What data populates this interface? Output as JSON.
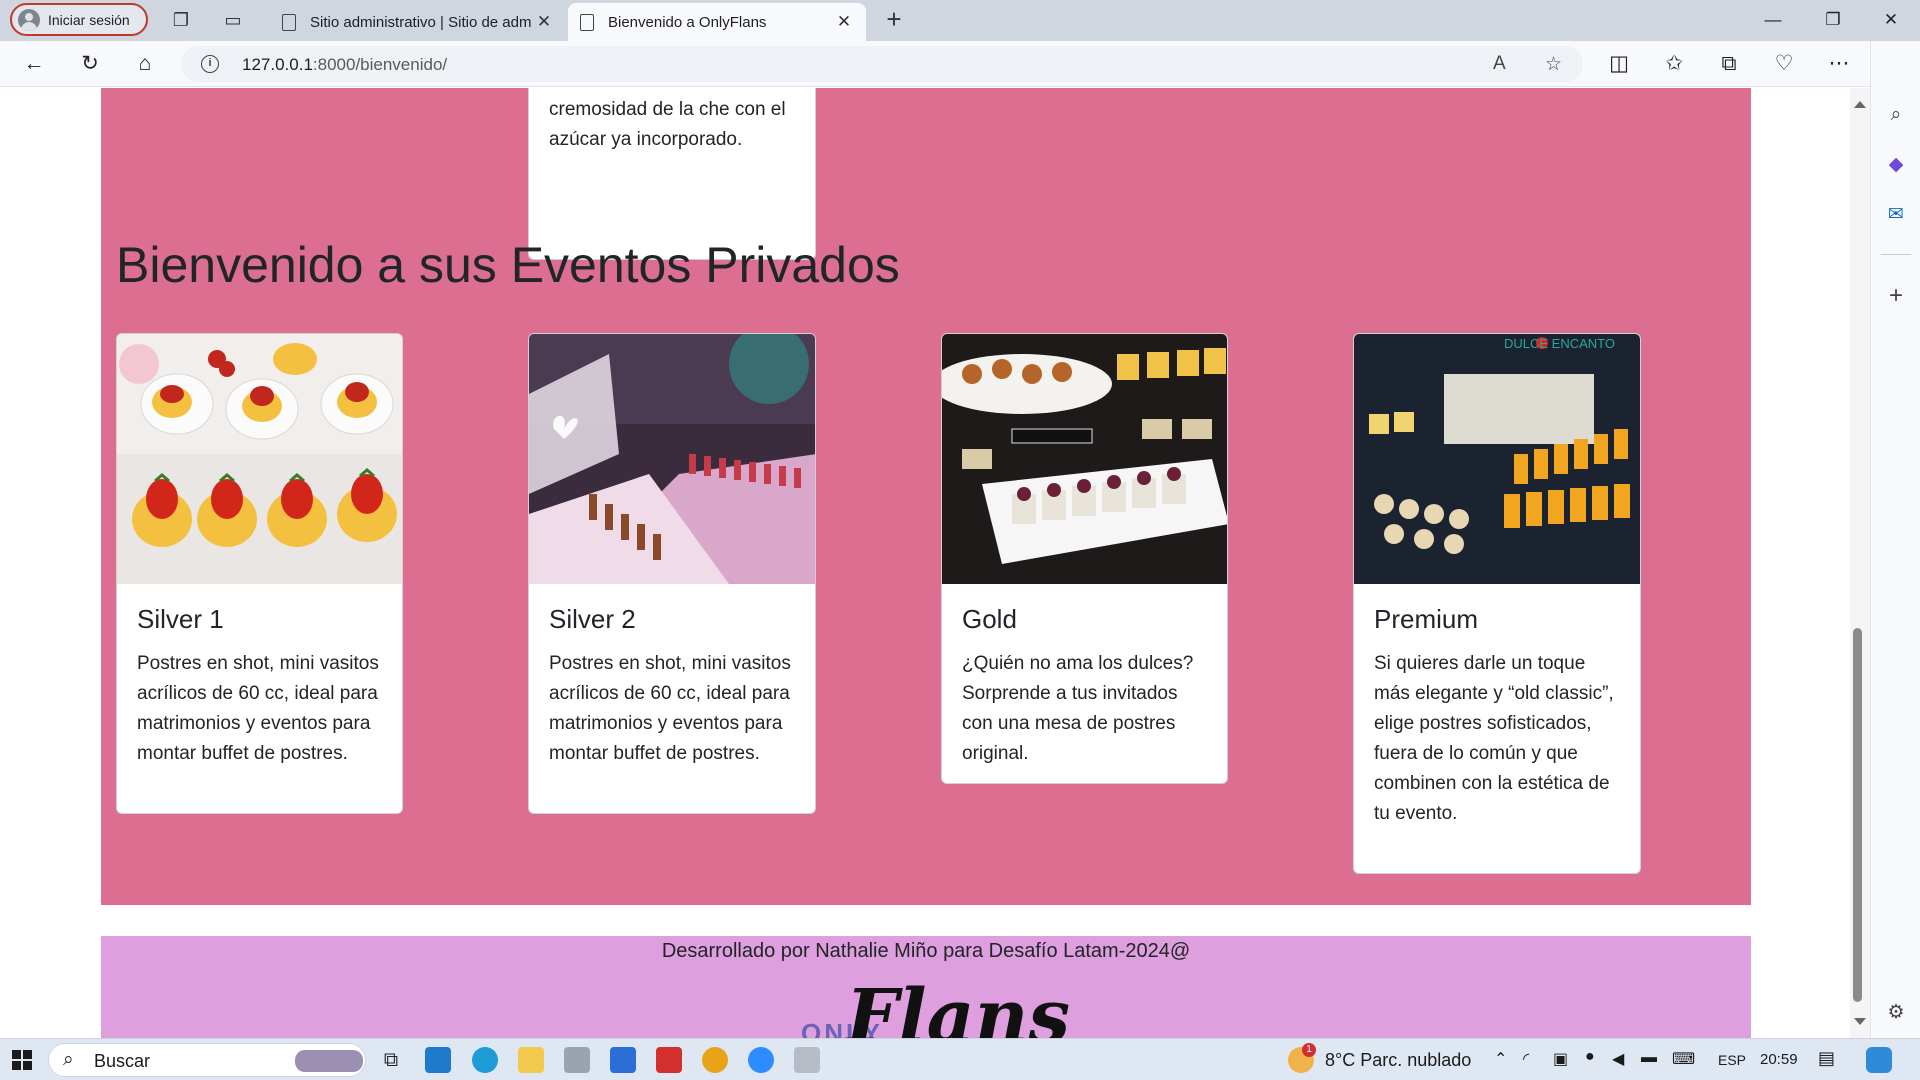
{
  "browser": {
    "profile_label": "Iniciar sesión",
    "tabs": [
      {
        "title": "Sitio administrativo | Sitio de adm"
      },
      {
        "title": "Bienvenido a OnlyFlans"
      }
    ],
    "address": {
      "host": "127.0.0.1",
      "path": ":8000/bienvenido/"
    }
  },
  "page": {
    "previous_card_tail": "cremosidad de la che con el azúcar ya incorporado.",
    "section_title": "Bienvenido a sus Eventos Privados",
    "cards": [
      {
        "title": "Silver 1",
        "text": "Postres en shot, mini vasitos acrílicos de 60 cc, ideal para matrimonios y eventos para montar buffet de postres."
      },
      {
        "title": "Silver 2",
        "text": "Postres en shot, mini vasitos acrílicos de 60 cc, ideal para matrimonios y eventos para montar buffet de postres."
      },
      {
        "title": "Gold",
        "text": "¿Quién no ama los dulces? Sorprende a tus invitados con una mesa de postres original."
      },
      {
        "title": "Premium",
        "text": "Si quieres darle un toque más elegante y “old classic”, elige postres sofisticados, fuera de lo común y que combinen con la estética de tu evento."
      }
    ],
    "card4_image_brand": "DULCE ENCANTO",
    "footer_credit": "Desarrollado por Nathalie Miño para Desafío Latam-2024@",
    "footer_logo_small": "ONLY",
    "footer_logo_large": "Flans"
  },
  "taskbar": {
    "search_placeholder": "Buscar",
    "weather": "8°C Parc. nublado",
    "weather_badge": "1",
    "language": "ESP",
    "time": "20:59"
  },
  "colors": {
    "page_pink": "#dc6f91",
    "footer_lilac": "#dd9fde",
    "logo_purple": "#6b63b5"
  }
}
